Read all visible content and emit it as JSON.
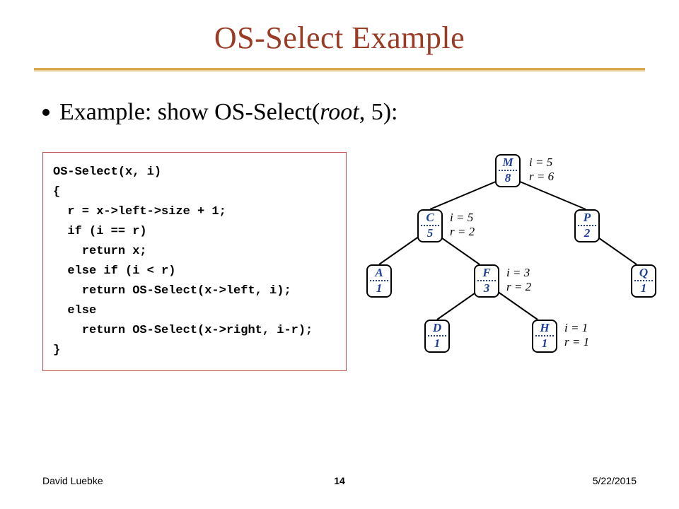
{
  "title": "OS-Select Example",
  "bullet_prefix": "Example: show OS-Select(",
  "bullet_root": "root",
  "bullet_suffix": ", 5):",
  "code": "OS-Select(x, i)\n{\n  r = x->left->size + 1;\n  if (i == r)\n    return x;\n  else if (i < r)\n    return OS-Select(x->left, i);\n  else\n    return OS-Select(x->right, i-r);\n}",
  "nodes": {
    "M": {
      "key": "M",
      "size": "8",
      "i": "i = 5",
      "r": "r = 6"
    },
    "C": {
      "key": "C",
      "size": "5",
      "i": "i = 5",
      "r": "r = 2"
    },
    "P": {
      "key": "P",
      "size": "2"
    },
    "A": {
      "key": "A",
      "size": "1"
    },
    "F": {
      "key": "F",
      "size": "3",
      "i": "i = 3",
      "r": "r = 2"
    },
    "Q": {
      "key": "Q",
      "size": "1"
    },
    "D": {
      "key": "D",
      "size": "1"
    },
    "H": {
      "key": "H",
      "size": "1",
      "i": "i = 1",
      "r": "r = 1"
    }
  },
  "footer": {
    "author": "David Luebke",
    "page": "14",
    "date": "5/22/2015"
  }
}
